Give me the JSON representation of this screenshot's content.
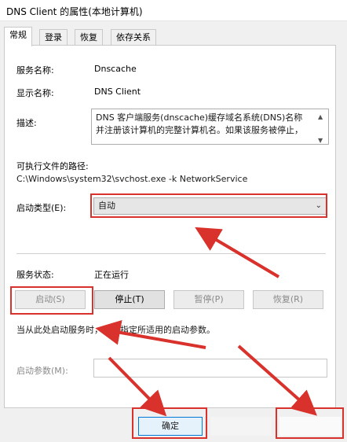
{
  "window": {
    "title": "DNS Client 的属性(本地计算机)"
  },
  "tabs": [
    {
      "label": "常规",
      "active": true
    },
    {
      "label": "登录",
      "active": false
    },
    {
      "label": "恢复",
      "active": false
    },
    {
      "label": "依存关系",
      "active": false
    }
  ],
  "general": {
    "service_name_label": "服务名称:",
    "service_name_value": "Dnscache",
    "display_name_label": "显示名称:",
    "display_name_value": "DNS Client",
    "description_label": "描述:",
    "description_line1": "DNS 客户端服务(dnscache)缓存域名系统(DNS)名称",
    "description_line2": "并注册该计算机的完整计算机名。如果该服务被停止，",
    "path_label": "可执行文件的路径:",
    "path_value": "C:\\Windows\\system32\\svchost.exe -k NetworkService",
    "startup_type_label": "启动类型(E):",
    "startup_type_value": "自动",
    "status_label": "服务状态:",
    "status_value": "正在运行",
    "buttons": {
      "start": "启动(S)",
      "stop": "停止(T)",
      "pause": "暂停(P)",
      "resume": "恢复(R)"
    },
    "hint": "当从此处启动服务时，你可指定所适用的启动参数。",
    "param_label": "启动参数(M):",
    "param_value": ""
  },
  "footer": {
    "ok": "确定"
  },
  "colors": {
    "highlight": "#d9312b",
    "accent": "#0078d7"
  }
}
